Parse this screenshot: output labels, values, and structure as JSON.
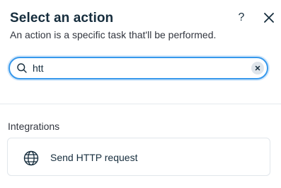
{
  "dialog": {
    "title": "Select an action",
    "subtitle": "An action is a specific task that'll be performed.",
    "help_label": "?",
    "close_icon": "close-icon"
  },
  "search": {
    "value": "htt",
    "placeholder": "",
    "icon": "search-icon",
    "clear_icon": "clear-icon"
  },
  "sections": [
    {
      "label": "Integrations",
      "items": [
        {
          "label": "Send HTTP request",
          "icon": "globe-icon"
        }
      ]
    }
  ],
  "colors": {
    "accent": "#3899ec",
    "text": "#162d3d",
    "border": "#e1e6eb"
  }
}
